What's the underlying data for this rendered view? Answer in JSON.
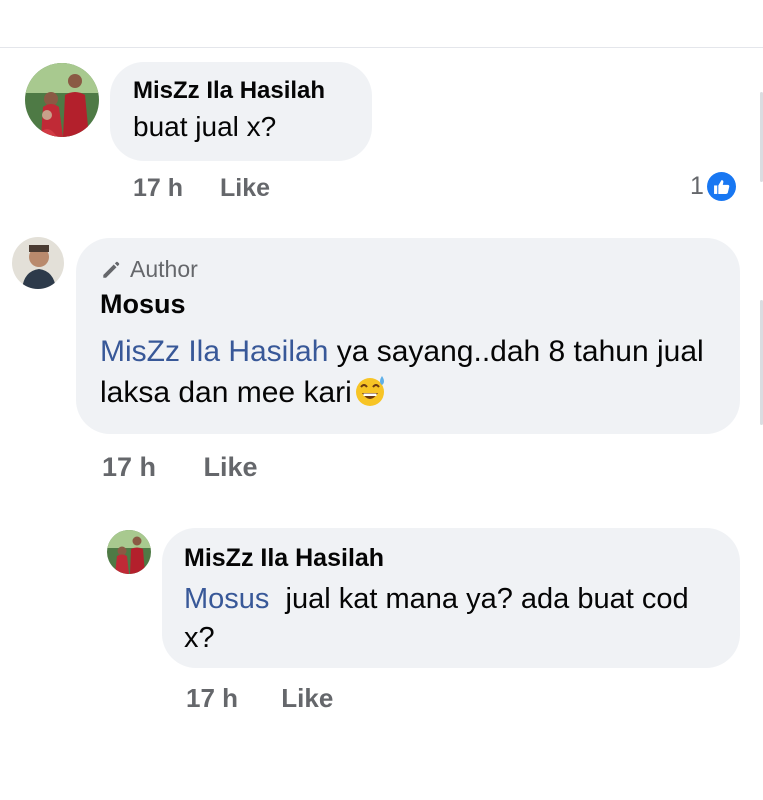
{
  "colors": {
    "bubble_bg": "#f0f2f5",
    "mention": "#385898",
    "meta_text": "#65676b",
    "like_blue": "#1877f2"
  },
  "comments": [
    {
      "author": "MisZz Ila Hasilah",
      "text": "buat jual x?",
      "time": "17 h",
      "like_label": "Like",
      "reaction_count": "1",
      "reaction_icon": "thumbs-up-icon"
    },
    {
      "author_badge_icon": "pencil-icon",
      "author_badge": "Author",
      "author": "Mosus",
      "mention": "MisZz Ila Hasilah",
      "text": " ya sayang..dah 8 tahun jual laksa dan mee kari",
      "emoji": "grinning-sweat-emoji",
      "time": "17 h",
      "like_label": "Like"
    },
    {
      "author": "MisZz Ila Hasilah",
      "mention": "Mosus",
      "text": "  jual kat mana ya? ada buat cod x?",
      "time": "17 h",
      "like_label": "Like"
    }
  ]
}
